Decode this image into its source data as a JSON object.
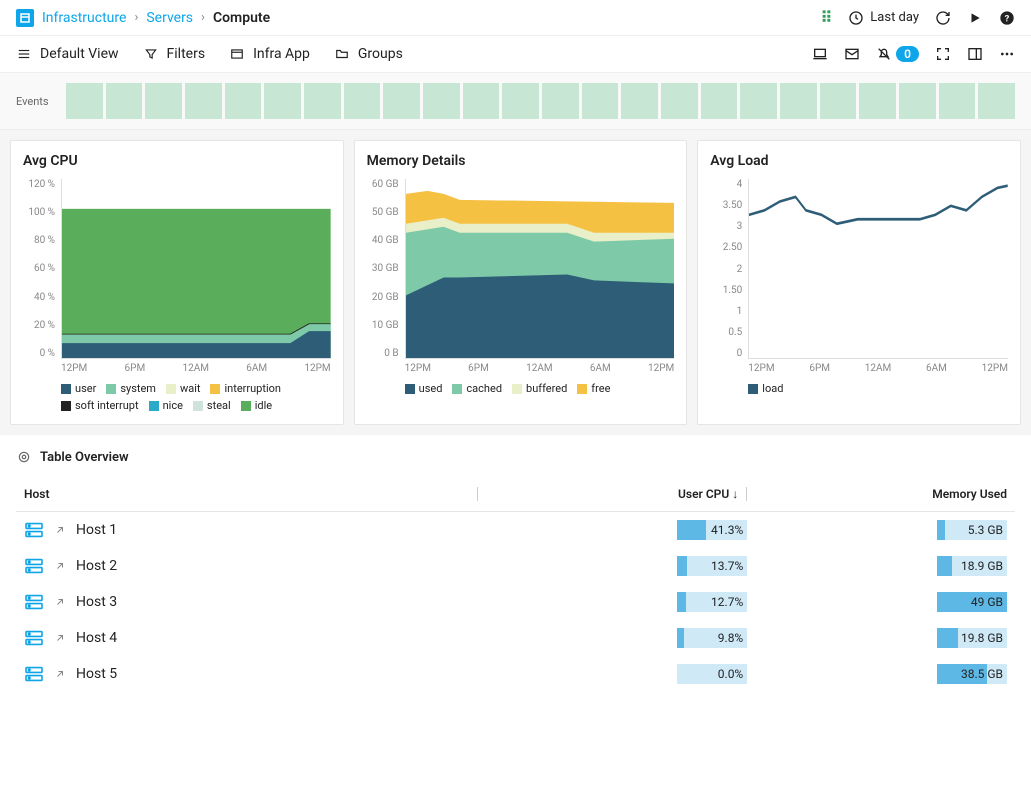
{
  "breadcrumb": {
    "root": "Infrastructure",
    "mid": "Servers",
    "current": "Compute"
  },
  "timerange": {
    "label": "Last day"
  },
  "toolbar": {
    "default_view": "Default View",
    "filters": "Filters",
    "infra_app": "Infra App",
    "groups": "Groups",
    "badge": "0"
  },
  "events": {
    "label": "Events",
    "blocks": 24
  },
  "cpu_chart": {
    "title": "Avg CPU",
    "y_ticks": [
      "120 %",
      "100 %",
      "80 %",
      "60 %",
      "40 %",
      "20 %",
      "0 %"
    ],
    "x_ticks": [
      "12PM",
      "6PM",
      "12AM",
      "6AM",
      "12PM"
    ],
    "legend": [
      {
        "name": "user",
        "color": "#2e5d78"
      },
      {
        "name": "system",
        "color": "#7ec9a7"
      },
      {
        "name": "wait",
        "color": "#e8efc9"
      },
      {
        "name": "interruption",
        "color": "#f5c142"
      },
      {
        "name": "soft interrupt",
        "color": "#222"
      },
      {
        "name": "nice",
        "color": "#2aa9c9"
      },
      {
        "name": "steal",
        "color": "#cfe3dc"
      },
      {
        "name": "idle",
        "color": "#5aad5a"
      }
    ]
  },
  "mem_chart": {
    "title": "Memory Details",
    "y_ticks": [
      "60 GB",
      "50 GB",
      "40 GB",
      "30 GB",
      "20 GB",
      "10 GB",
      "0 B"
    ],
    "x_ticks": [
      "12PM",
      "6PM",
      "12AM",
      "6AM",
      "12PM"
    ],
    "legend": [
      {
        "name": "used",
        "color": "#2e5d78"
      },
      {
        "name": "cached",
        "color": "#7ec9a7"
      },
      {
        "name": "buffered",
        "color": "#e8efc9"
      },
      {
        "name": "free",
        "color": "#f5c142"
      }
    ]
  },
  "load_chart": {
    "title": "Avg Load",
    "y_ticks": [
      "4",
      "3.50",
      "3",
      "2.50",
      "2",
      "1.50",
      "1",
      "0.5",
      "0"
    ],
    "x_ticks": [
      "12PM",
      "6PM",
      "12AM",
      "6AM",
      "12PM"
    ],
    "legend": [
      {
        "name": "load",
        "color": "#2e5d78"
      }
    ]
  },
  "table": {
    "title": "Table Overview",
    "columns": {
      "host": "Host",
      "user_cpu": "User CPU ↓",
      "mem_used": "Memory Used"
    },
    "rows": [
      {
        "host": "Host 1",
        "cpu_label": "41.3%",
        "cpu_pct": 41.3,
        "mem_label": "5.3 GB",
        "mem_pct": 11
      },
      {
        "host": "Host 2",
        "cpu_label": "13.7%",
        "cpu_pct": 13.7,
        "mem_label": "18.9 GB",
        "mem_pct": 22
      },
      {
        "host": "Host 3",
        "cpu_label": "12.7%",
        "cpu_pct": 12.7,
        "mem_label": "49 GB",
        "mem_pct": 100
      },
      {
        "host": "Host 4",
        "cpu_label": "9.8%",
        "cpu_pct": 9.8,
        "mem_label": "19.8 GB",
        "mem_pct": 30
      },
      {
        "host": "Host 5",
        "cpu_label": "0.0%",
        "cpu_pct": 0,
        "mem_label": "38.5 GB",
        "mem_pct": 72
      }
    ]
  },
  "chart_data": [
    {
      "id": "avg_cpu",
      "type": "area",
      "title": "Avg CPU",
      "xlabel": "",
      "ylabel": "%",
      "ylim": [
        0,
        120
      ],
      "x": [
        "12PM",
        "6PM",
        "12AM",
        "6AM",
        "12PM"
      ],
      "series": [
        {
          "name": "user",
          "values": [
            10,
            10,
            10,
            10,
            18
          ]
        },
        {
          "name": "system",
          "values": [
            6,
            6,
            6,
            6,
            8
          ]
        },
        {
          "name": "wait",
          "values": [
            1,
            1,
            1,
            1,
            1
          ]
        },
        {
          "name": "interruption",
          "values": [
            0,
            0,
            0,
            0,
            0
          ]
        },
        {
          "name": "soft interrupt",
          "values": [
            0,
            0,
            0,
            0,
            0
          ]
        },
        {
          "name": "nice",
          "values": [
            0,
            0,
            0,
            0,
            0
          ]
        },
        {
          "name": "steal",
          "values": [
            0,
            0,
            0,
            0,
            0
          ]
        },
        {
          "name": "idle",
          "values": [
            83,
            83,
            83,
            83,
            73
          ]
        }
      ]
    },
    {
      "id": "memory_details",
      "type": "area",
      "title": "Memory Details",
      "xlabel": "",
      "ylabel": "GB",
      "ylim": [
        0,
        60
      ],
      "x": [
        "12PM",
        "6PM",
        "12AM",
        "6AM",
        "12PM"
      ],
      "series": [
        {
          "name": "used",
          "values": [
            21,
            27,
            27,
            27,
            25
          ]
        },
        {
          "name": "cached",
          "values": [
            18,
            14,
            14,
            14,
            15
          ]
        },
        {
          "name": "buffered",
          "values": [
            3,
            3,
            3,
            3,
            3
          ]
        },
        {
          "name": "free",
          "values": [
            13,
            9,
            9,
            9,
            9
          ]
        }
      ]
    },
    {
      "id": "avg_load",
      "type": "line",
      "title": "Avg Load",
      "xlabel": "",
      "ylabel": "",
      "ylim": [
        0,
        4
      ],
      "x": [
        "12PM",
        "6PM",
        "12AM",
        "6AM",
        "12PM"
      ],
      "series": [
        {
          "name": "load",
          "values": [
            3.2,
            3.5,
            3.1,
            3.1,
            3.9
          ]
        }
      ]
    }
  ]
}
